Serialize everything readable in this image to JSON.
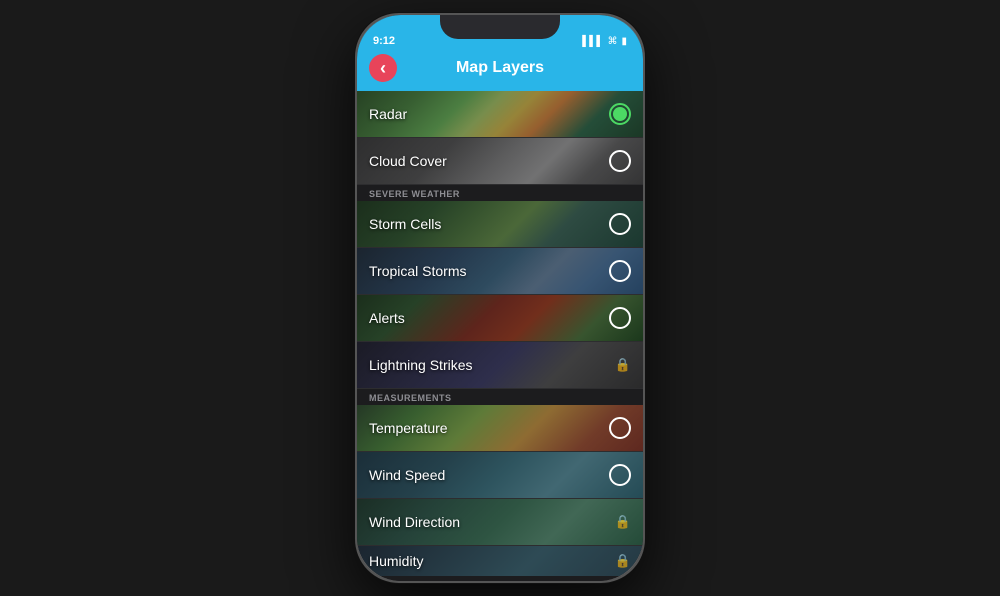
{
  "phone": {
    "status": {
      "time": "9:12",
      "signal": "▌▌▌",
      "wifi": "WiFi",
      "battery": "Battery"
    },
    "header": {
      "title": "Map Layers",
      "back_label": "‹"
    },
    "sections": {
      "severe_weather_label": "SEVERE WEATHER",
      "measurements_label": "MEASUREMENTS"
    },
    "layers": [
      {
        "id": "radar",
        "label": "Radar",
        "bg": "bg-radar",
        "control": "active",
        "locked": false
      },
      {
        "id": "cloud-cover",
        "label": "Cloud Cover",
        "bg": "bg-cloud",
        "control": "circle",
        "locked": false
      },
      {
        "id": "storm-cells",
        "label": "Storm Cells",
        "bg": "bg-storm-cells",
        "control": "circle",
        "locked": false
      },
      {
        "id": "tropical-storms",
        "label": "Tropical Storms",
        "bg": "bg-tropical",
        "control": "circle",
        "locked": false
      },
      {
        "id": "alerts",
        "label": "Alerts",
        "bg": "bg-alerts",
        "control": "circle",
        "locked": false
      },
      {
        "id": "lightning-strikes",
        "label": "Lightning Strikes",
        "bg": "bg-lightning",
        "control": "lock",
        "locked": true
      },
      {
        "id": "temperature",
        "label": "Temperature",
        "bg": "bg-temp",
        "control": "circle",
        "locked": false
      },
      {
        "id": "wind-speed",
        "label": "Wind Speed",
        "bg": "bg-wind-speed",
        "control": "circle",
        "locked": false
      },
      {
        "id": "wind-direction",
        "label": "Wind Direction",
        "bg": "bg-wind-dir",
        "control": "lock",
        "locked": true
      },
      {
        "id": "humidity",
        "label": "Humidity",
        "bg": "bg-humidity",
        "control": "lock",
        "locked": true
      }
    ]
  }
}
